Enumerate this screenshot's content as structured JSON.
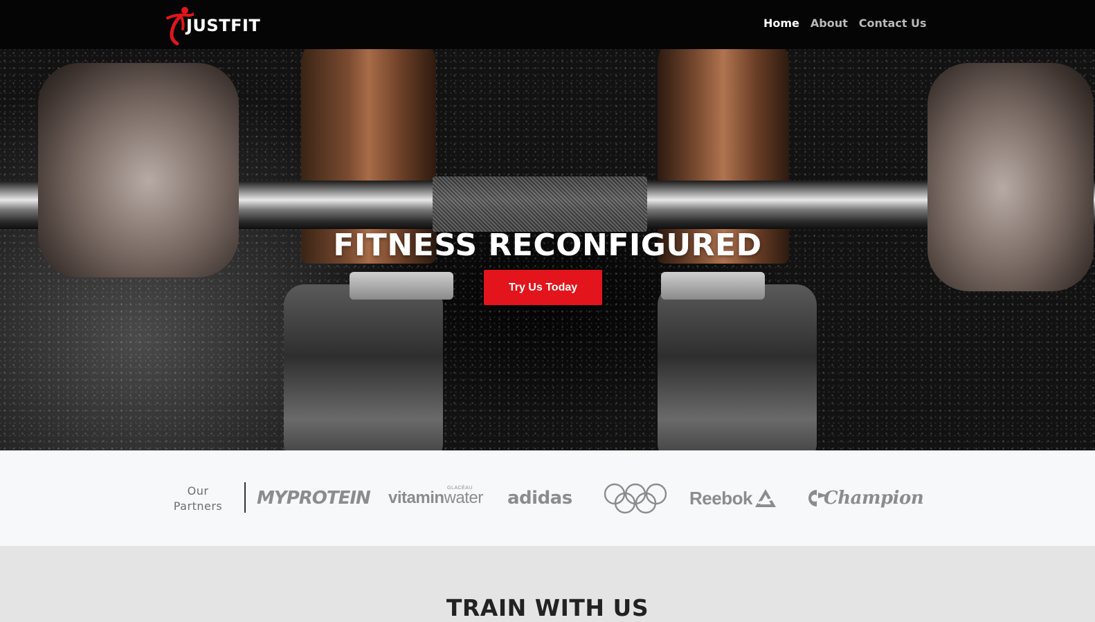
{
  "brand": {
    "name": "JUSTFIT",
    "accent_color": "#e3141c",
    "logo_icon": "runner-figure-icon"
  },
  "nav": {
    "items": [
      {
        "label": "Home",
        "active": true
      },
      {
        "label": "About",
        "active": false
      },
      {
        "label": "Contact Us",
        "active": false
      }
    ]
  },
  "hero": {
    "title": "FITNESS RECONFIGURED",
    "cta_label": "Try Us Today",
    "background": "barbell-deadlift-photo"
  },
  "partners": {
    "label_line1": "Our",
    "label_line2": "Partners",
    "logos": [
      {
        "name": "MYPROTEIN"
      },
      {
        "name": "vitaminwater",
        "part1": "vitamin",
        "part2": "water",
        "small": "GLACÉAU"
      },
      {
        "name": "adidas"
      },
      {
        "name": "olympic-rings-icon"
      },
      {
        "name": "Reebok"
      },
      {
        "name": "Champion"
      }
    ]
  },
  "train": {
    "title": "TRAIN WITH US"
  }
}
